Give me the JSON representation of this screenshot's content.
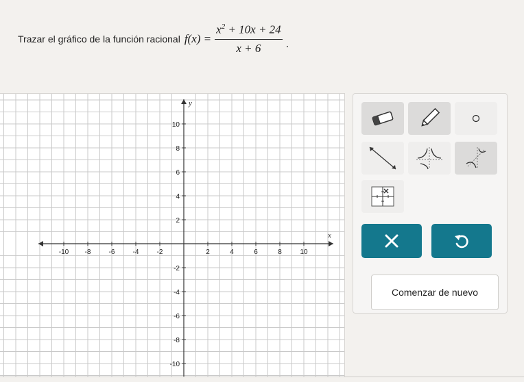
{
  "prompt": {
    "text": "Trazar el gráfico de la función racional",
    "function_name": "f(x) =",
    "numerator_x": "x",
    "numerator_exp": "2",
    "numerator_rest": " + 10x + 24",
    "denominator": "x + 6",
    "end_punct": "."
  },
  "graph": {
    "x_axis_label": "x",
    "y_axis_label": "y",
    "x_ticks": [
      "-10",
      "-8",
      "-6",
      "-4",
      "-2",
      "2",
      "4",
      "6",
      "8",
      "10"
    ],
    "y_ticks": [
      "10",
      "8",
      "6",
      "4",
      "2",
      "-2",
      "-4",
      "-6",
      "-8",
      "-10"
    ],
    "x_range": [
      -11,
      11
    ],
    "y_range": [
      -11,
      11
    ],
    "grid": true
  },
  "tools": {
    "items": [
      {
        "name": "eraser-tool",
        "icon": "eraser-icon"
      },
      {
        "name": "pencil-tool",
        "icon": "pencil-icon"
      },
      {
        "name": "point-tool",
        "icon": "circle-icon"
      },
      {
        "name": "line-tool",
        "icon": "line-icon"
      },
      {
        "name": "rational-curve-tool",
        "icon": "rational-curve-icon"
      },
      {
        "name": "rational-curve-alt-tool",
        "icon": "rational-curve-alt-icon"
      },
      {
        "name": "hole-tool",
        "icon": "hole-grid-icon"
      }
    ],
    "clear_icon": "x-mark-icon",
    "undo_icon": "undo-icon",
    "restart_label": "Comenzar de nuevo"
  },
  "colors": {
    "accent": "#14788d",
    "grid": "#c9c9c9",
    "axis": "#333333"
  }
}
